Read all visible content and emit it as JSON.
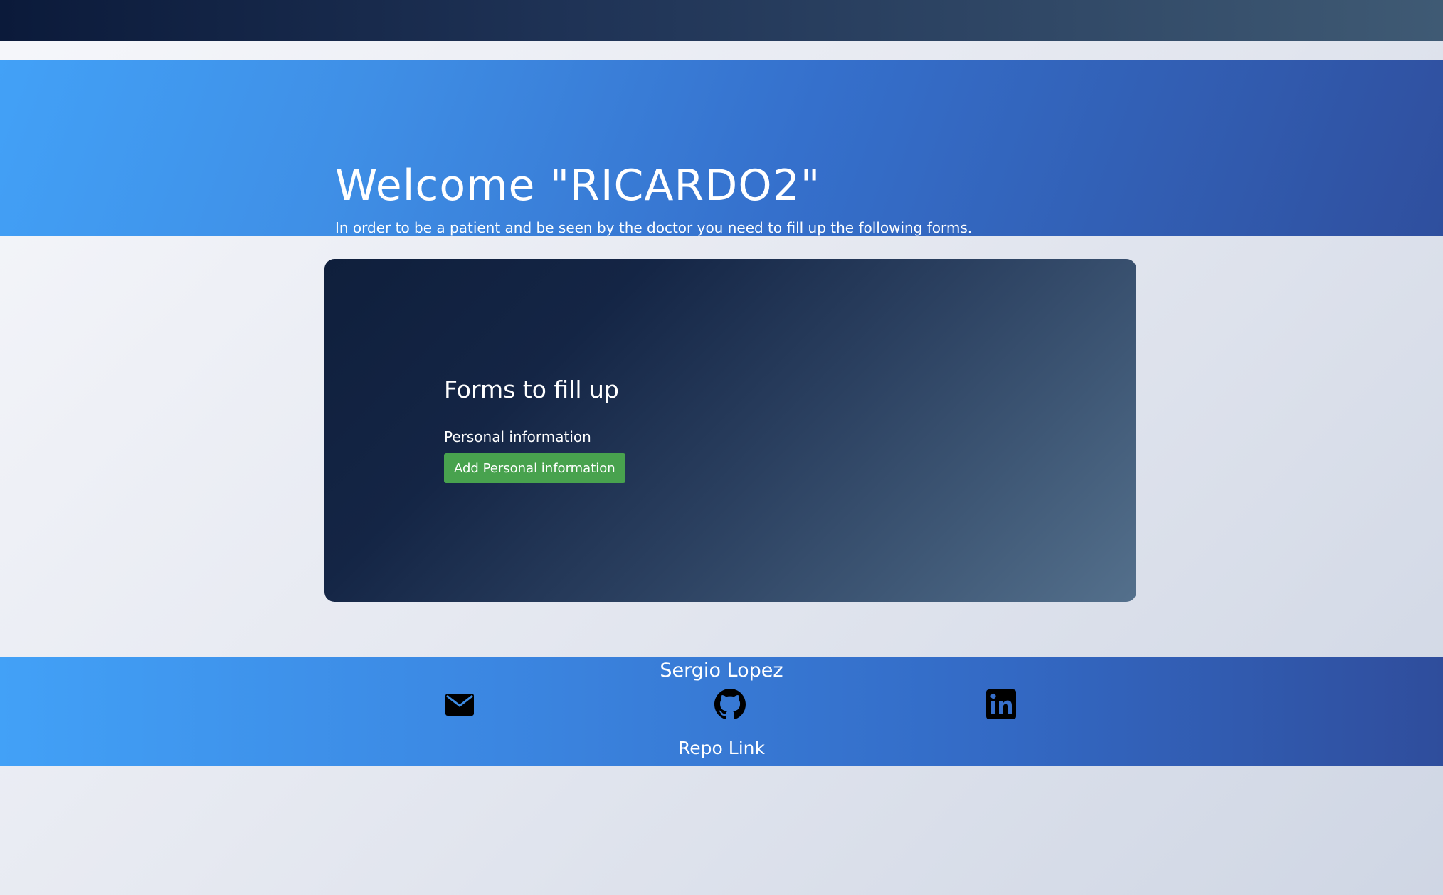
{
  "hero": {
    "title": "Welcome \"RICARDO2\"",
    "subtitle": "In order to be a patient and be seen by the doctor you need to fill up the following forms."
  },
  "forms": {
    "title": "Forms to fill up",
    "personal_label": "Personal information",
    "add_button_label": "Add Personal information"
  },
  "footer": {
    "name": "Sergio Lopez",
    "repo_link_label": "Repo Link",
    "icons": [
      "mail-icon",
      "github-icon",
      "linkedin-icon"
    ]
  },
  "colors": {
    "topbar": "#0b1a3a",
    "hero_start": "#42a1f7",
    "hero_end": "#2f4f9e",
    "card_start": "#0f1f3c",
    "card_end": "#54708c",
    "button": "#48a24e",
    "icon": "#000000"
  }
}
